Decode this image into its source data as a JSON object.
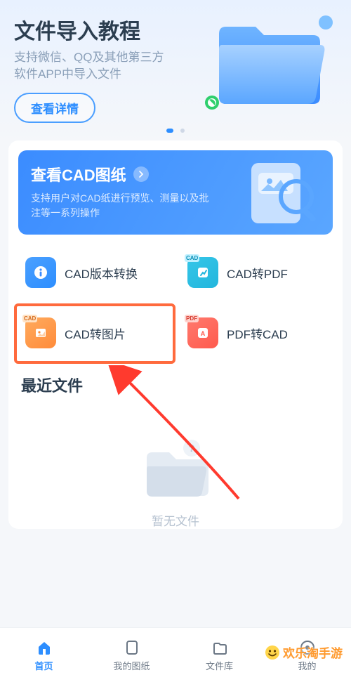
{
  "hero": {
    "title": "文件导入教程",
    "subtitle": "支持微信、QQ及其他第三方软件APP中导入文件",
    "button": "查看详情"
  },
  "bigcard": {
    "title": "查看CAD图纸",
    "subtitle": "支持用户对CAD纸进行预览、测量以及批注等一系列操作"
  },
  "features": [
    {
      "label": "CAD版本转换",
      "iconClass": "icon-blue",
      "badge": ""
    },
    {
      "label": "CAD转PDF",
      "iconClass": "icon-cyan",
      "badge": "CAD"
    },
    {
      "label": "CAD转图片",
      "iconClass": "icon-orange",
      "badge": "CAD"
    },
    {
      "label": "PDF转CAD",
      "iconClass": "icon-red",
      "badge": "PDF"
    }
  ],
  "recent": {
    "title": "最近文件",
    "empty": "暂无文件"
  },
  "tabs": [
    {
      "label": "首页",
      "active": true
    },
    {
      "label": "我的图纸",
      "active": false
    },
    {
      "label": "文件库",
      "active": false
    },
    {
      "label": "我的",
      "active": false
    }
  ],
  "watermark": "欢乐淘手游"
}
